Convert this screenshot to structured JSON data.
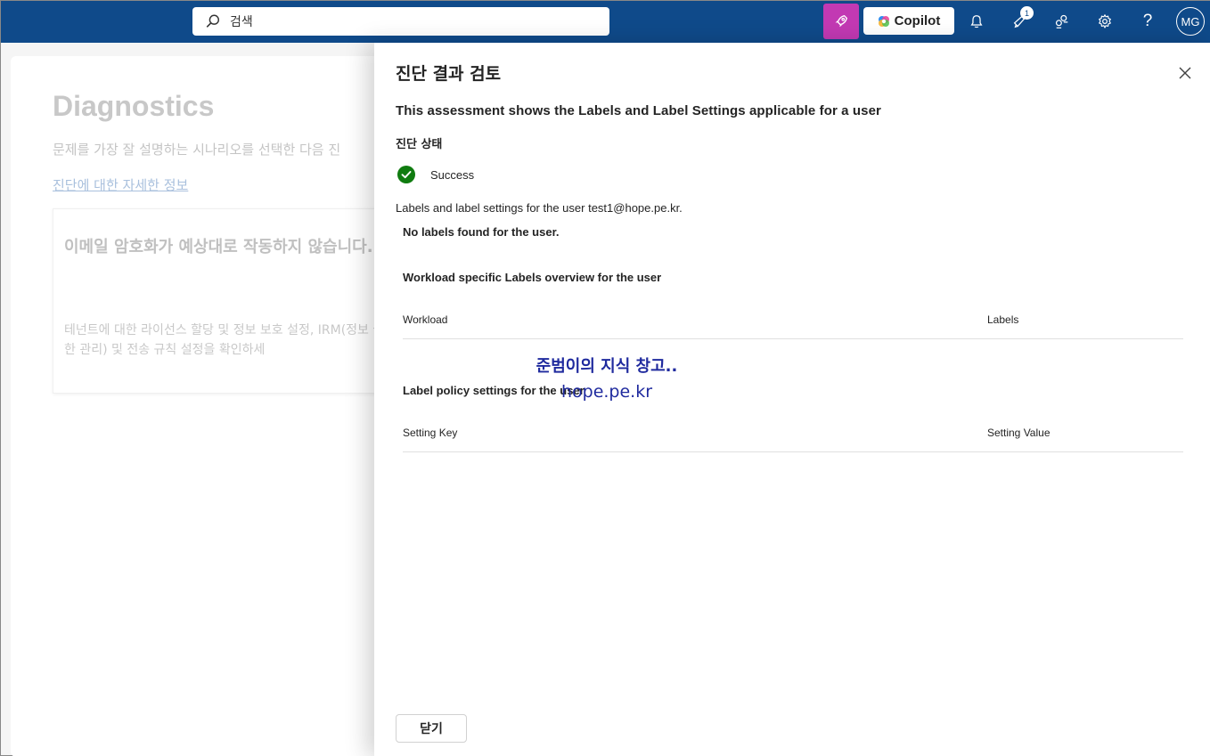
{
  "topbar": {
    "search_placeholder": "검색",
    "copilot_label": "Copilot",
    "notification_badge": "1",
    "help_label": "?",
    "avatar_initials": "MG"
  },
  "background_page": {
    "title": "Diagnostics",
    "description": "문제를 가장 잘 설명하는 시나리오를 선택한 다음 진",
    "link": "진단에 대한 자세한 정보",
    "card_title": "이메일 암호화가 예상대로 작동하지 않습니다.",
    "card_description": "테넌트에 대한 라이선스 할당 및 정보 보호 설정, IRM(정보 권한 관리) 및 전송 규칙 설정을 확인하세"
  },
  "panel": {
    "title": "진단 결과 검토",
    "subtitle": "This assessment shows the Labels and Label Settings applicable for a user",
    "status_label": "진단 상태",
    "status_value": "Success",
    "info": "Labels and label settings for the user test1@hope.pe.kr.",
    "no_labels": "No labels found for the user.",
    "workload_section": {
      "title": "Workload specific Labels overview for the user",
      "columns": [
        "Workload",
        "Labels"
      ]
    },
    "policy_section": {
      "title": "Label policy settings for the user",
      "columns": [
        "Setting Key",
        "Setting Value"
      ]
    },
    "watermark_line1": "준범이의 지식 창고..",
    "watermark_line2": "hope.pe.kr",
    "close_button": "닫기"
  },
  "colors": {
    "topbar": "#0f4a8a",
    "copilot_tile": "#c239b3",
    "success": "#107c10",
    "watermark": "#1f2a9e"
  }
}
